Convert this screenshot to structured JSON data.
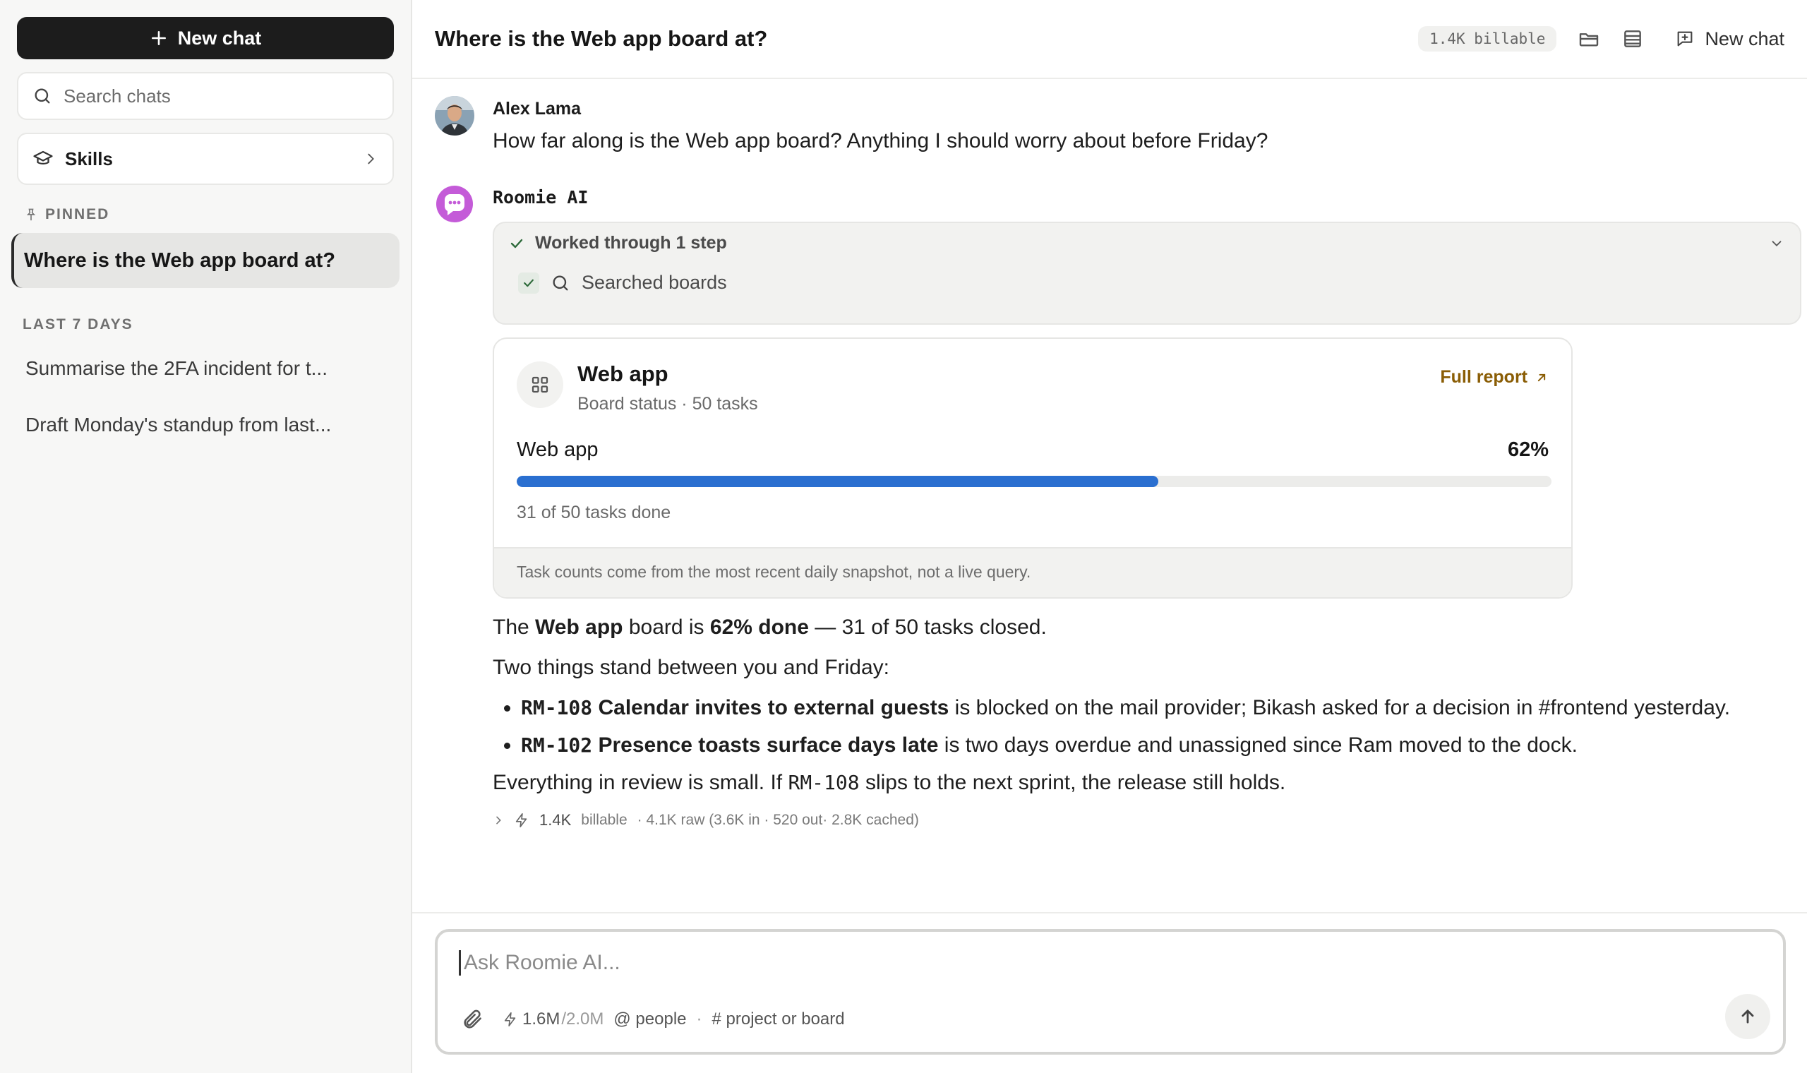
{
  "sidebar": {
    "new_chat_label": "New chat",
    "search_placeholder": "Search chats",
    "skills_label": "Skills",
    "pinned_label": "PINNED",
    "pinned_items": [
      {
        "label": "Where is the Web app board at?"
      }
    ],
    "recent_label": "LAST 7 DAYS",
    "recent_items": [
      {
        "label": "Summarise the 2FA incident for t..."
      },
      {
        "label": "Draft Monday's standup from last..."
      }
    ]
  },
  "header": {
    "title": "Where is the Web app board at?",
    "billable": "1.4K billable",
    "new_chat_label": "New chat"
  },
  "user_message": {
    "name": "Alex Lama",
    "text": "How far along is the Web app board? Anything I should worry about before Friday?"
  },
  "ai_message": {
    "name": "Roomie AI",
    "steps_title": "Worked through 1 step",
    "steps": [
      {
        "label": "Searched boards"
      }
    ],
    "board": {
      "name": "Web app",
      "subtitle": "Board status · 50 tasks",
      "full_report_label": "Full report",
      "progress_label": "Web app",
      "progress_pct_text": "62%",
      "progress_value": 0.62,
      "progress_caption": "31 of 50 tasks done",
      "footnote": "Task counts come from the most recent daily snapshot, not a live query."
    },
    "answer": {
      "p1_a": "The ",
      "p1_b": "Web app",
      "p1_c": " board is ",
      "p1_d": "62% done",
      "p1_e": " — 31 of 50 tasks closed.",
      "p2": "Two things stand between you and Friday:",
      "bullet1_id": "RM-108",
      "bullet1_bold": " Calendar invites to external guests",
      "bullet1_rest": " is blocked on the mail provider; Bikash asked for a decision in #frontend yesterday.",
      "bullet2_id": "RM-102",
      "bullet2_bold": " Presence toasts surface days late",
      "bullet2_rest": " is two days overdue and unassigned since Ram moved to the dock.",
      "p3_a": "Everything in review is small. If ",
      "p3_id": "RM-108",
      "p3_b": " slips to the next sprint, the release still holds."
    },
    "usage": {
      "value": "1.4K",
      "billable_label": "billable",
      "details": "· 4.1K raw (3.6K in · 520 out· 2.8K cached)"
    }
  },
  "composer": {
    "placeholder": "Ask Roomie AI...",
    "quota_used": "1.6M",
    "quota_total": "/2.0M",
    "people_hint": "@ people",
    "separator": "·",
    "project_hint": "# project or board"
  },
  "colors": {
    "accent_progress": "#2a6fd0",
    "full_report_link": "#8a5d05",
    "new_chat_bg": "#1c1c1c",
    "ai_avatar": "#b34fe0"
  }
}
